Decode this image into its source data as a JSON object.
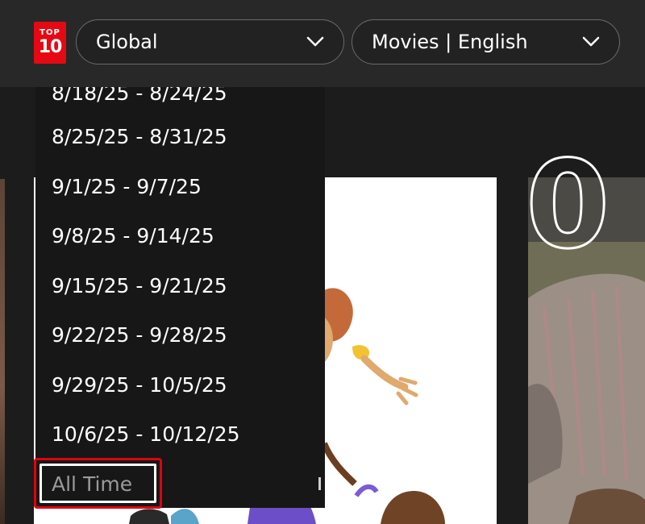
{
  "header": {
    "logo": {
      "line1": "TOP",
      "line2": "10"
    },
    "region_select": {
      "value": "Global"
    },
    "category_select": {
      "value": "Movies | English"
    }
  },
  "dropdown": {
    "partial_item": "8/18/25 - 8/24/25",
    "items": [
      "8/25/25 - 8/31/25",
      "9/1/25 - 9/7/25",
      "9/8/25 - 9/14/25",
      "9/15/25 - 9/21/25",
      "9/22/25 - 9/28/25",
      "9/29/25 - 10/5/25",
      "10/6/25 - 10/12/25"
    ],
    "all_time": "All Time"
  },
  "poster_rank": "0"
}
